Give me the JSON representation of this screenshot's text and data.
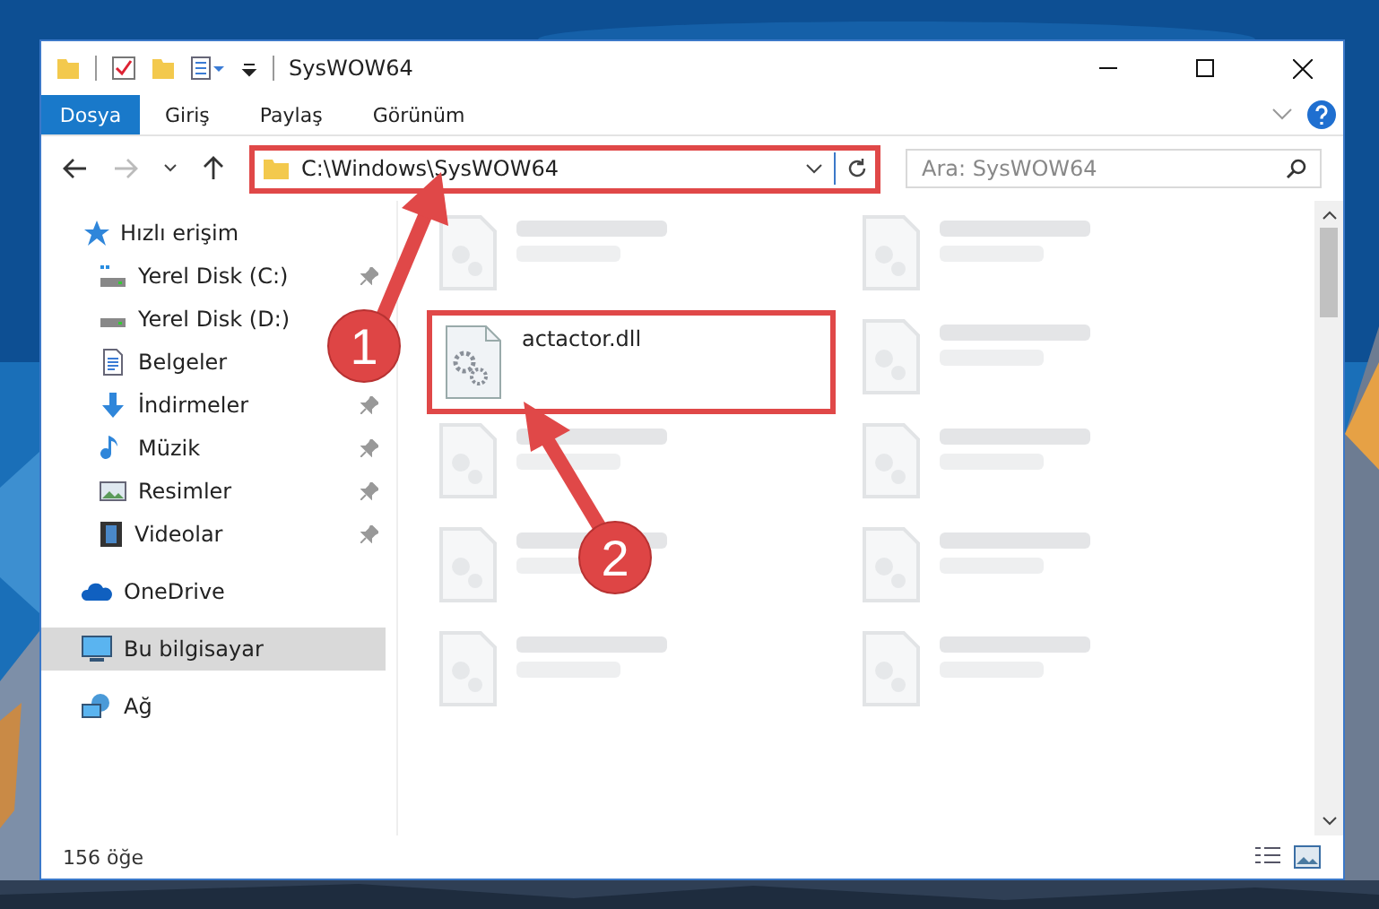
{
  "window": {
    "title": "SysWOW64"
  },
  "ribbon_tabs": [
    {
      "label": "Dosya",
      "kind": "file"
    },
    {
      "label": "Giriş",
      "kind": "tab"
    },
    {
      "label": "Paylaş",
      "kind": "tab"
    },
    {
      "label": "Görünüm",
      "kind": "tab"
    }
  ],
  "address": {
    "path": "C:\\Windows\\SysWOW64",
    "annotated": true
  },
  "search": {
    "placeholder": "Ara: SysWOW64"
  },
  "sidebar": {
    "items": [
      {
        "label": "Hızlı erişim",
        "kind": "star",
        "selected": false,
        "children": [
          {
            "label": "Yerel Disk (C:)",
            "kind": "system-drive",
            "pinned": true,
            "selected": false
          },
          {
            "label": "Yerel Disk (D:)",
            "kind": "drive",
            "selected": false
          },
          {
            "label": "Belgeler",
            "kind": "documents",
            "selected": false
          },
          {
            "label": "İndirmeler",
            "kind": "downloads",
            "pinned": true,
            "selected": false
          },
          {
            "label": "Müzik",
            "kind": "music",
            "pinned": true,
            "selected": false
          },
          {
            "label": "Resimler",
            "kind": "pictures",
            "pinned": true,
            "selected": false
          },
          {
            "label": "Videolar",
            "kind": "videos",
            "pinned": true,
            "selected": false
          }
        ]
      },
      {
        "label": "OneDrive",
        "kind": "cloud",
        "selected": false
      },
      {
        "label": "Bu bilgisayar",
        "kind": "computer",
        "selected": true
      },
      {
        "label": "Ağ",
        "kind": "network",
        "selected": false
      }
    ]
  },
  "files": [
    {
      "kind": "blurred"
    },
    {
      "kind": "blurred"
    },
    {
      "kind": "file",
      "name": "actactor.dll",
      "annotated": true
    },
    {
      "kind": "blurred"
    },
    {
      "kind": "blurred"
    },
    {
      "kind": "blurred"
    },
    {
      "kind": "blurred"
    },
    {
      "kind": "blurred"
    },
    {
      "kind": "blurred"
    },
    {
      "kind": "blurred"
    }
  ],
  "status_bar": {
    "count": "156 öğe"
  },
  "annotations": [
    {
      "label": "1"
    },
    {
      "label": "2"
    }
  ]
}
